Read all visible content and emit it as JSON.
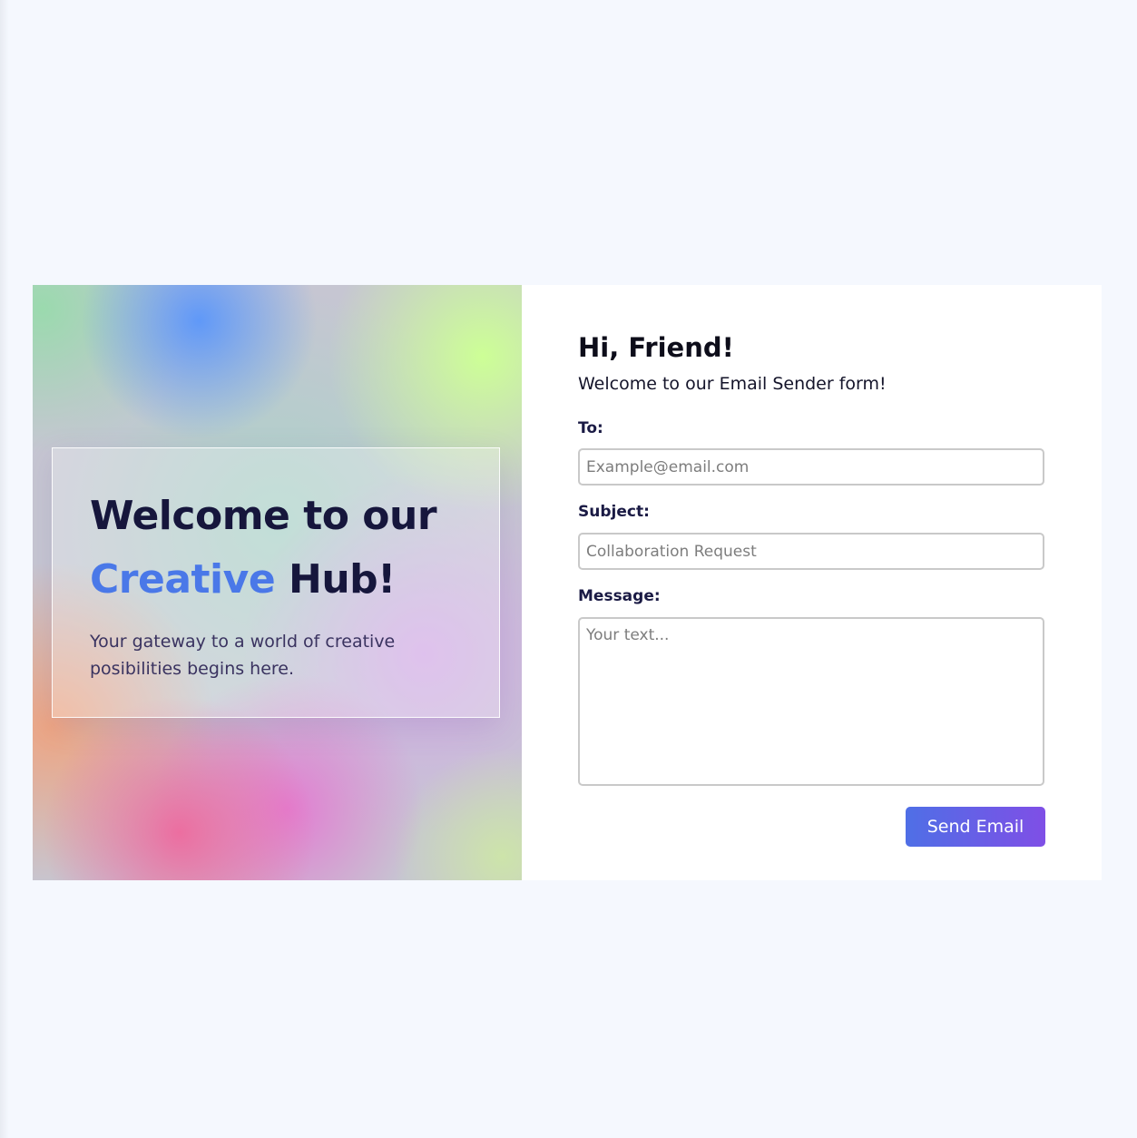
{
  "hero": {
    "headline_line1": "Welcome to our",
    "headline_accent": "Creative",
    "headline_line2_rest": " Hub!",
    "tagline": "Your gateway to a world of creative posibilities begins here."
  },
  "form": {
    "greeting": "Hi, Friend!",
    "subgreeting": "Welcome to our Email Sender form!",
    "to": {
      "label": "To:",
      "placeholder": "Example@email.com",
      "value": ""
    },
    "subject": {
      "label": "Subject:",
      "placeholder": "Collaboration Request",
      "value": ""
    },
    "message": {
      "label": "Message:",
      "placeholder": "Your text...",
      "value": ""
    },
    "submit_label": "Send Email"
  },
  "colors": {
    "page_background": "#f5f8fe",
    "accent_blue": "#4a78e8",
    "headline_dark": "#16163c",
    "button_gradient_start": "#4f6fe6",
    "button_gradient_end": "#7f4fe6"
  }
}
